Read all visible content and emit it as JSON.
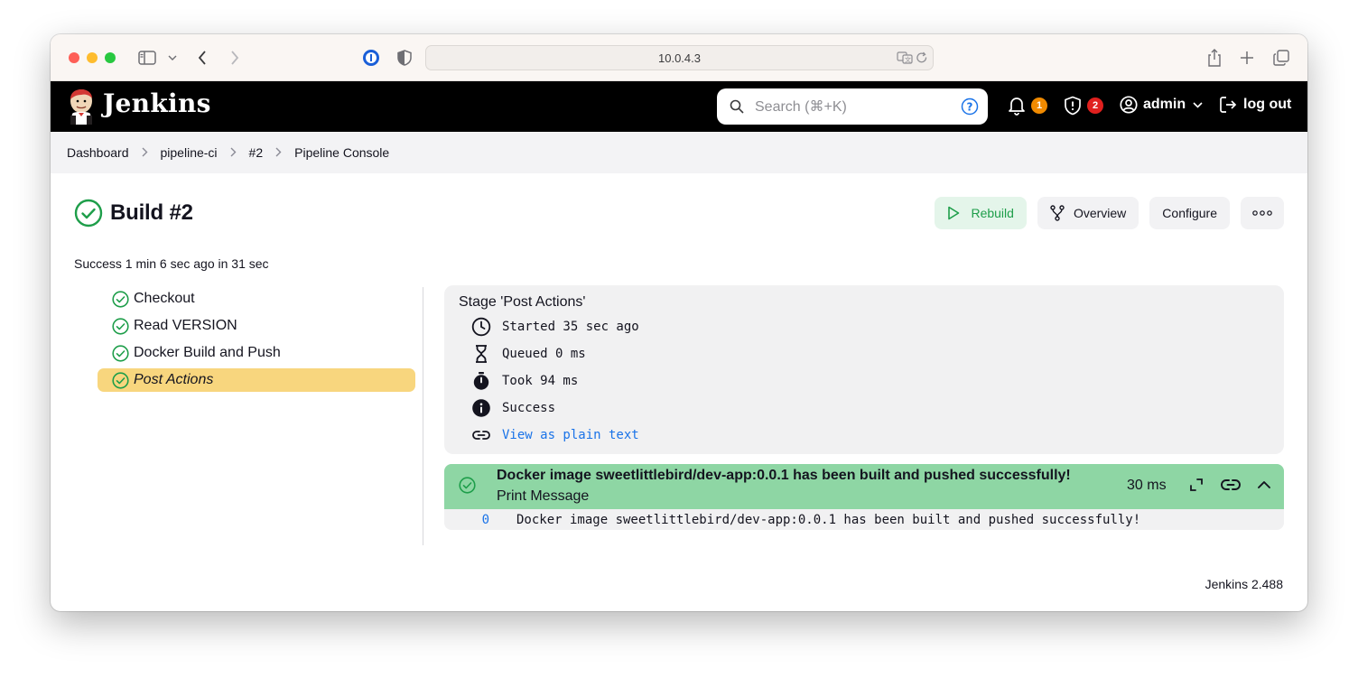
{
  "browser": {
    "url": "10.0.4.3"
  },
  "header": {
    "app_title": "Jenkins",
    "search_placeholder": "Search (⌘+K)",
    "notifications_count": "1",
    "security_count": "2",
    "user": "admin",
    "logout": "log out",
    "colors": {
      "notification_badge": "#f08a00",
      "security_badge": "#e0201e"
    }
  },
  "breadcrumb": {
    "items": [
      "Dashboard",
      "pipeline-ci",
      "#2",
      "Pipeline Console"
    ]
  },
  "page": {
    "title": "Build #2",
    "subtitle": "Success 1 min 6 sec ago in 31 sec",
    "actions": {
      "rebuild": "Rebuild",
      "overview": "Overview",
      "configure": "Configure"
    }
  },
  "stages": [
    {
      "label": "Checkout"
    },
    {
      "label": "Read VERSION"
    },
    {
      "label": "Docker Build and Push"
    },
    {
      "label": "Post Actions"
    }
  ],
  "stage_details": {
    "title": "Stage 'Post Actions'",
    "started": "Started 35 sec ago",
    "queued": "Queued 0 ms",
    "took": "Took 94 ms",
    "status": "Success",
    "plain_text_link": "View as plain text"
  },
  "step": {
    "title": "Docker image sweetlittlebird/dev-app:0.0.1 has been built and pushed successfully!",
    "subtitle": "Print Message",
    "duration": "30 ms",
    "log": [
      {
        "num": "0",
        "text": "Docker image sweetlittlebird/dev-app:0.0.1 has been built and pushed successfully!"
      }
    ]
  },
  "footer": {
    "version": "Jenkins 2.488"
  },
  "colors": {
    "success_green": "#1e9e4a",
    "active_stage": "#f8d67e",
    "step_header": "#8ed6a4",
    "link_blue": "#1a73e8"
  }
}
